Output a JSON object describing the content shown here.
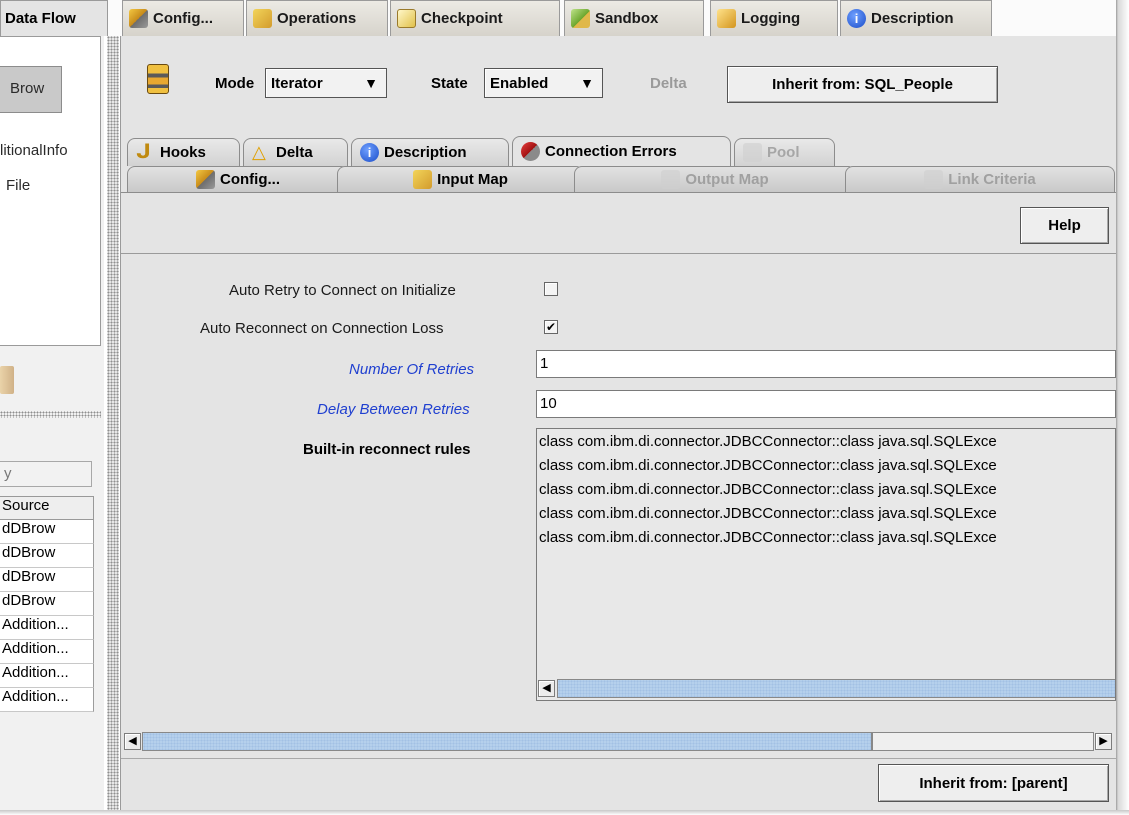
{
  "top_tabs": [
    {
      "label": "Data Flow",
      "icon": "none"
    },
    {
      "label": "Config...",
      "icon": "config-icon"
    },
    {
      "label": "Operations",
      "icon": "operations-icon"
    },
    {
      "label": "Checkpoint",
      "icon": "checkpoint-icon"
    },
    {
      "label": "Sandbox",
      "icon": "sandbox-icon"
    },
    {
      "label": "Logging",
      "icon": "logging-icon"
    },
    {
      "label": "Description",
      "icon": "info-icon"
    }
  ],
  "left": {
    "selected_item": "Brow",
    "items": [
      "litionalInfo",
      "File"
    ],
    "table_header_partial": "y",
    "table_column": "Source",
    "rows": [
      "dDBrow",
      "dDBrow",
      "dDBrow",
      "dDBrow",
      "Addition...",
      "Addition...",
      "Addition...",
      "Addition..."
    ]
  },
  "header": {
    "mode_label": "Mode",
    "mode_value": "Iterator",
    "state_label": "State",
    "state_value": "Enabled",
    "delta_label": "Delta",
    "inherit_button": "Inherit from: SQL_People"
  },
  "sub_tabs": [
    {
      "label": "Hooks"
    },
    {
      "label": "Delta"
    },
    {
      "label": "Description"
    },
    {
      "label": "Connection Errors"
    },
    {
      "label": "Pool"
    }
  ],
  "row2_tabs": [
    {
      "label": "Config..."
    },
    {
      "label": "Input Map"
    },
    {
      "label": "Output Map"
    },
    {
      "label": "Link Criteria"
    }
  ],
  "help_button": "Help",
  "form": {
    "auto_retry_label": "Auto Retry to Connect on Initialize",
    "auto_retry_checked": false,
    "auto_reconnect_label": "Auto Reconnect on Connection Loss",
    "auto_reconnect_checked": true,
    "retries_label": "Number Of Retries",
    "retries_value": "1",
    "delay_label": "Delay Between Retries",
    "delay_value": "10",
    "rules_label": "Built-in reconnect rules",
    "rules": [
      "class com.ibm.di.connector.JDBCConnector::class java.sql.SQLExce",
      "class com.ibm.di.connector.JDBCConnector::class java.sql.SQLExce",
      "class com.ibm.di.connector.JDBCConnector::class java.sql.SQLExce",
      "class com.ibm.di.connector.JDBCConnector::class java.sql.SQLExce",
      "class com.ibm.di.connector.JDBCConnector::class java.sql.SQLExce"
    ]
  },
  "footer_button": "Inherit from: [parent]",
  "colors": {
    "panel": "#e4e4e4",
    "link_label": "#2040d0",
    "scroll_track": "#b5d0ec"
  }
}
